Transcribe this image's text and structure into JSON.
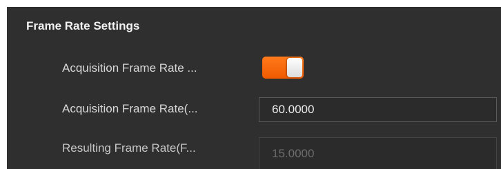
{
  "section": {
    "title": "Frame Rate Settings"
  },
  "rows": [
    {
      "label": "Acquisition Frame Rate ...",
      "control": "toggle",
      "enabled": true
    },
    {
      "label": "Acquisition Frame Rate(...",
      "control": "input",
      "value": "60.0000"
    },
    {
      "label": "Resulting Frame Rate(F...",
      "control": "readonly-input",
      "value": "15.0000"
    }
  ],
  "colors": {
    "background": "#2f2f2f",
    "accent": "#ff6a00",
    "text": "#d8d8d8",
    "disabled_text": "#6e6e6e"
  }
}
